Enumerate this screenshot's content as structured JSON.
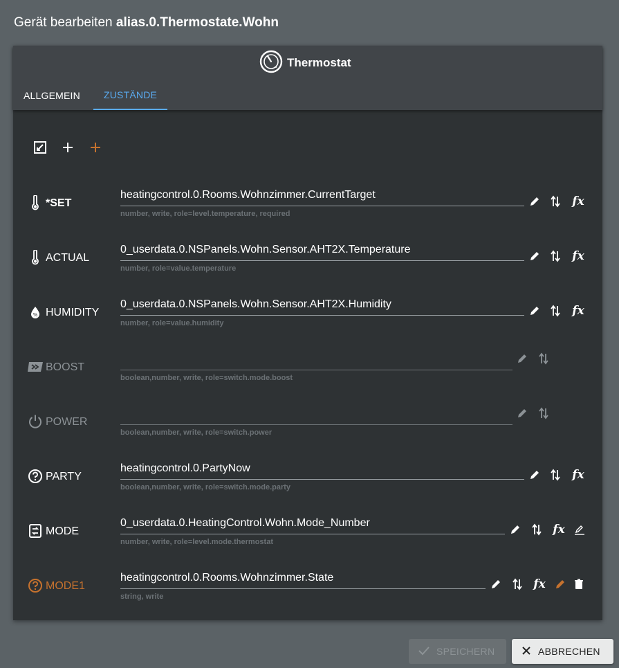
{
  "dialog": {
    "title_prefix": "Gerät bearbeiten",
    "title_id": "alias.0.Thermostate.Wohn"
  },
  "device": {
    "type_icon": "thermostat-icon",
    "title": "Thermostat"
  },
  "tabs": [
    {
      "label": "ALLGEMEIN",
      "active": false
    },
    {
      "label": "ZUSTÄNDE",
      "active": true
    }
  ],
  "toolbar": {
    "icons": [
      "expand-icon",
      "plus-icon",
      "plus-orange-icon"
    ]
  },
  "states": [
    {
      "name": "*SET",
      "icon": "thermometer-icon",
      "value": "heatingcontrol.0.Rooms.Wohnzimmer.CurrentTarget",
      "hint": "number, write, role=level.temperature, required"
    },
    {
      "name": "ACTUAL",
      "icon": "thermometer-icon",
      "value": "0_userdata.0.NSPanels.Wohn.Sensor.AHT2X.Temperature",
      "hint": "number, role=value.temperature"
    },
    {
      "name": "HUMIDITY",
      "icon": "water-percent-icon",
      "value": "0_userdata.0.NSPanels.Wohn.Sensor.AHT2X.Humidity",
      "hint": "number, role=value.humidity"
    },
    {
      "name": "BOOST",
      "icon": "boost-icon",
      "value": "",
      "hint": "boolean,number, write, role=switch.mode.boost"
    },
    {
      "name": "POWER",
      "icon": "power-icon",
      "value": "",
      "hint": "boolean,number, write, role=switch.power"
    },
    {
      "name": "PARTY",
      "icon": "help-circle-icon",
      "value": "heatingcontrol.0.PartyNow",
      "hint": "boolean,number, write, role=switch.mode.party"
    },
    {
      "name": "MODE",
      "icon": "mode-swap-icon",
      "value": "0_userdata.0.HeatingControl.Wohn.Mode_Number",
      "hint": "number, write, role=level.mode.thermostat"
    },
    {
      "name": "MODE1",
      "icon": "help-circle-icon",
      "value": "heatingcontrol.0.Rooms.Wohnzimmer.State",
      "hint": "string, write"
    }
  ],
  "buttons": {
    "save": "SPEICHERN",
    "cancel": "ABBRECHEN"
  },
  "colors": {
    "accent": "#5aabf0",
    "custom_state": "#c6722e"
  }
}
